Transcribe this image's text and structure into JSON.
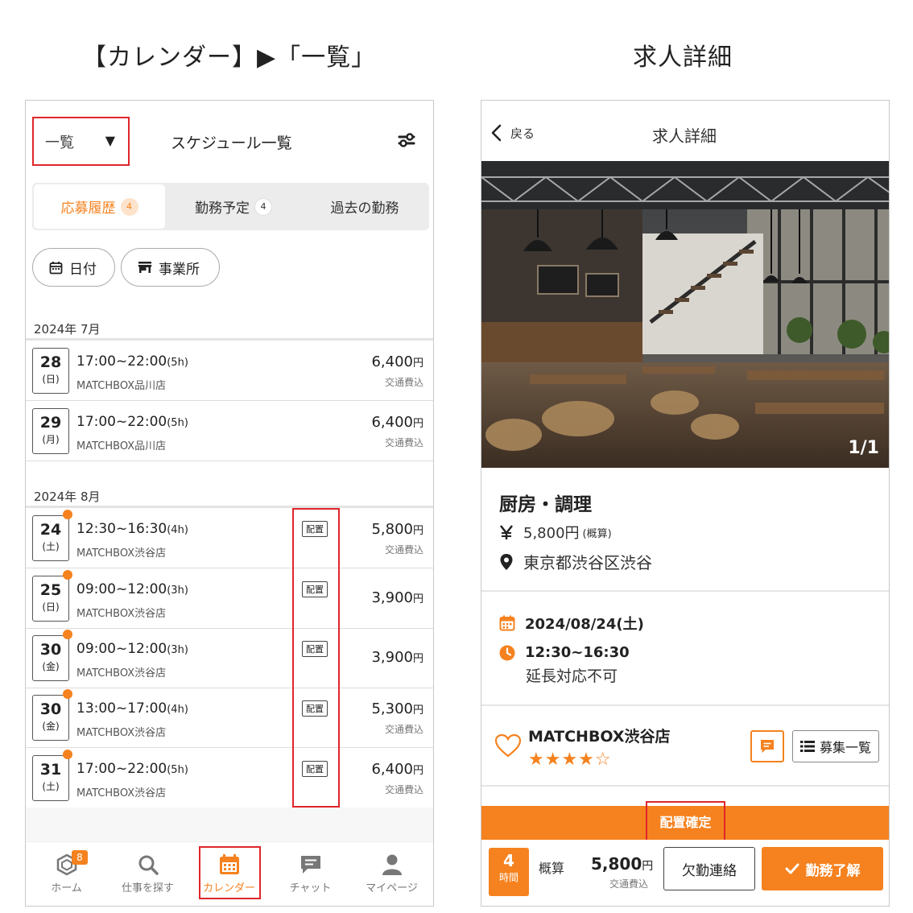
{
  "captions": {
    "left": "【カレンダー】▶「一覧」",
    "right": "求人詳細"
  },
  "left": {
    "header": {
      "view_select": "一覧",
      "caret": "▼",
      "title": "スケジュール一覧",
      "filter_icon": "sliders-icon"
    },
    "tabs": [
      {
        "label": "応募履歴",
        "count": "4",
        "active": true
      },
      {
        "label": "勤務予定",
        "count": "4",
        "active": false
      },
      {
        "label": "過去の勤務",
        "count": "",
        "active": false
      }
    ],
    "chips": [
      {
        "label": "日付",
        "icon": "calendar-icon"
      },
      {
        "label": "事業所",
        "icon": "store-icon"
      }
    ],
    "groups": [
      {
        "month": "2024年 7月",
        "rows": [
          {
            "day": "28",
            "weekday": "(日)",
            "time": "17:00~22:00",
            "hours": "(5h)",
            "shop": "MATCHBOX品川店",
            "price": "6,400",
            "yen": "円",
            "sub": "交通費込",
            "tag": "",
            "dot": false
          },
          {
            "day": "29",
            "weekday": "(月)",
            "time": "17:00~22:00",
            "hours": "(5h)",
            "shop": "MATCHBOX品川店",
            "price": "6,400",
            "yen": "円",
            "sub": "交通費込",
            "tag": "",
            "dot": false
          }
        ]
      },
      {
        "month": "2024年 8月",
        "rows": [
          {
            "day": "24",
            "weekday": "(土)",
            "time": "12:30~16:30",
            "hours": "(4h)",
            "shop": "MATCHBOX渋谷店",
            "price": "5,800",
            "yen": "円",
            "sub": "交通費込",
            "tag": "配置",
            "dot": true
          },
          {
            "day": "25",
            "weekday": "(日)",
            "time": "09:00~12:00",
            "hours": "(3h)",
            "shop": "MATCHBOX渋谷店",
            "price": "3,900",
            "yen": "円",
            "sub": "",
            "tag": "配置",
            "dot": true
          },
          {
            "day": "30",
            "weekday": "(金)",
            "time": "09:00~12:00",
            "hours": "(3h)",
            "shop": "MATCHBOX渋谷店",
            "price": "3,900",
            "yen": "円",
            "sub": "",
            "tag": "配置",
            "dot": true
          },
          {
            "day": "30",
            "weekday": "(金)",
            "time": "13:00~17:00",
            "hours": "(4h)",
            "shop": "MATCHBOX渋谷店",
            "price": "5,300",
            "yen": "円",
            "sub": "交通費込",
            "tag": "配置",
            "dot": true
          },
          {
            "day": "31",
            "weekday": "(土)",
            "time": "17:00~22:00",
            "hours": "(5h)",
            "shop": "MATCHBOX渋谷店",
            "price": "6,400",
            "yen": "円",
            "sub": "交通費込",
            "tag": "配置",
            "dot": true
          }
        ]
      }
    ],
    "nav": [
      {
        "label": "ホーム",
        "icon": "home-hex-icon",
        "badge": "8",
        "active": false
      },
      {
        "label": "仕事を探す",
        "icon": "search-icon",
        "badge": "",
        "active": false
      },
      {
        "label": "カレンダー",
        "icon": "calendar-icon",
        "badge": "",
        "active": true
      },
      {
        "label": "チャット",
        "icon": "chat-icon",
        "badge": "",
        "active": false
      },
      {
        "label": "マイページ",
        "icon": "user-icon",
        "badge": "",
        "active": false
      }
    ]
  },
  "right": {
    "header": {
      "back": "戻る",
      "title": "求人詳細"
    },
    "photo": {
      "counter": "1/1",
      "subject": "cafe-interior-photo"
    },
    "job": {
      "title": "厨房・調理",
      "pay": "5,800円",
      "pay_note": "(概算)",
      "location": "東京都渋谷区渋谷"
    },
    "schedule": {
      "date": "2024/08/24(土)",
      "time": "12:30~16:30",
      "note": "延長対応不可"
    },
    "store": {
      "name": "MATCHBOX渋谷店",
      "stars": "★★★★☆",
      "rating": 4,
      "list_button": "募集一覧"
    },
    "status_bar": "配置確定",
    "footer": {
      "hours": "4",
      "hours_unit": "時間",
      "gaisan": "概算",
      "price": "5,800",
      "yen": "円",
      "sub": "交通費込",
      "absent_button": "欠勤連絡",
      "accept_button": "勤務了解"
    },
    "colors": {
      "accent": "#f5821f",
      "highlight": "#e0262b"
    }
  }
}
